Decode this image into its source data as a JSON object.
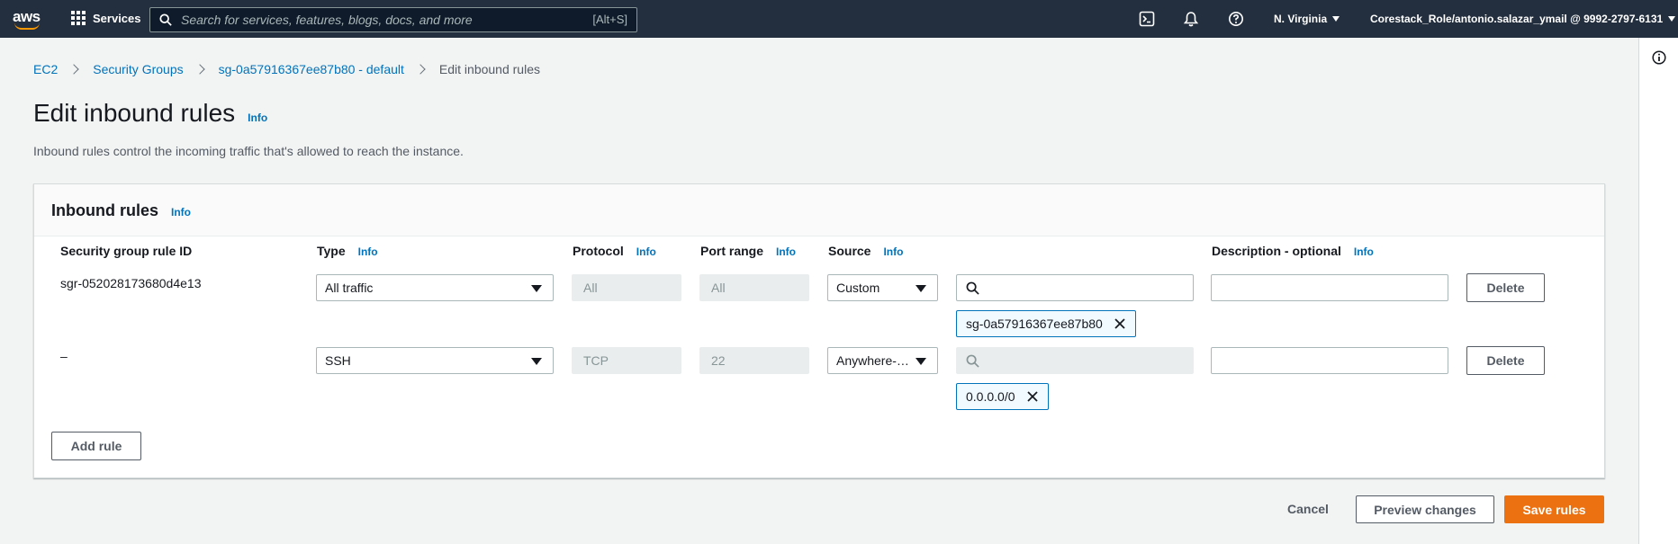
{
  "topnav": {
    "logo_text": "aws",
    "services_label": "Services",
    "search_placeholder": "Search for services, features, blogs, docs, and more",
    "search_shortcut": "[Alt+S]",
    "region": "N. Virginia",
    "account": "Corestack_Role/antonio.salazar_ymail @ 9992-2797-6131"
  },
  "breadcrumb": {
    "items": [
      "EC2",
      "Security Groups",
      "sg-0a57916367ee87b80 - default"
    ],
    "current": "Edit inbound rules"
  },
  "page": {
    "title": "Edit inbound rules",
    "info": "Info",
    "description": "Inbound rules control the incoming traffic that's allowed to reach the instance."
  },
  "panel": {
    "title": "Inbound rules",
    "info": "Info",
    "columns": {
      "rule_id": "Security group rule ID",
      "type": "Type",
      "protocol": "Protocol",
      "port_range": "Port range",
      "source": "Source",
      "description": "Description - optional",
      "info": "Info"
    },
    "rows": [
      {
        "rule_id": "sgr-052028173680d4e13",
        "type": "All traffic",
        "protocol": "All",
        "port_range": "All",
        "source": "Custom",
        "token": "sg-0a57916367ee87b80",
        "description": "",
        "delete": "Delete"
      },
      {
        "rule_id": "–",
        "type": "SSH",
        "protocol": "TCP",
        "port_range": "22",
        "source": "Anywhere-…",
        "token": "0.0.0.0/0",
        "description": "",
        "delete": "Delete"
      }
    ],
    "add_rule": "Add rule"
  },
  "footer": {
    "cancel": "Cancel",
    "preview": "Preview changes",
    "save": "Save rules"
  },
  "colors": {
    "nav_bg": "#232f3e",
    "link": "#0073bb",
    "primary": "#ec7211"
  }
}
